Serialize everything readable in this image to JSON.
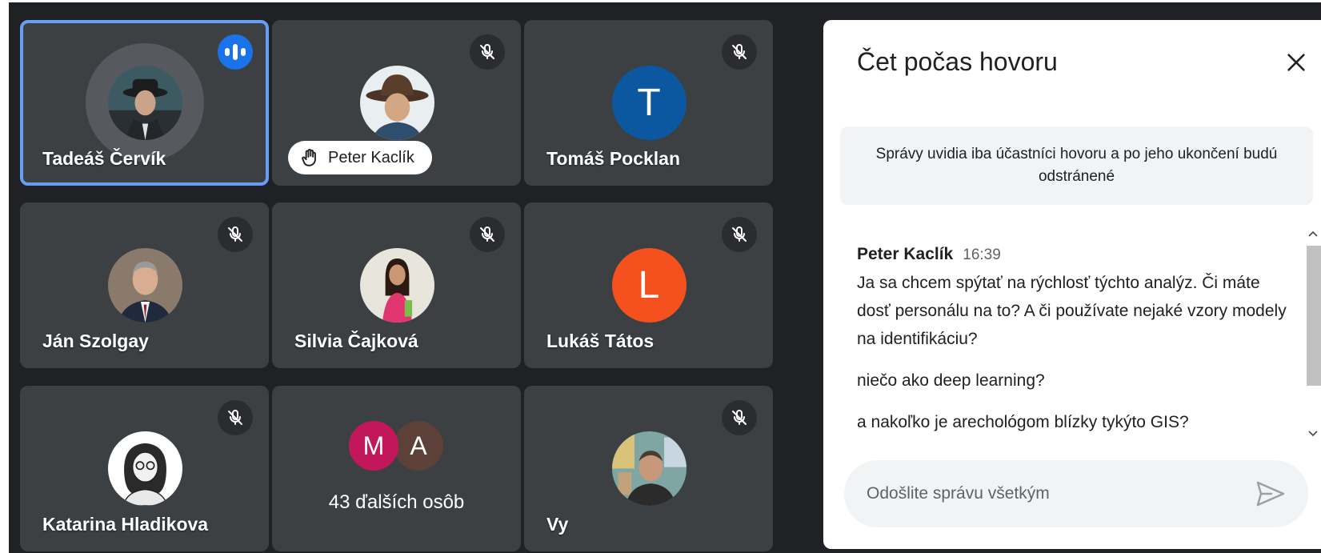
{
  "colors": {
    "background": "#202124",
    "tile": "#3c4043",
    "active_outline": "#669df6",
    "speaking_badge": "#1a73e8",
    "avatar_T": "#0b57a0",
    "avatar_L": "#f4511e",
    "avatar_M": "#c2185b",
    "avatar_A": "#5d4037"
  },
  "tiles": [
    {
      "name": "Tadeáš Červík",
      "icon": "speaking-indicator",
      "speaking": true
    },
    {
      "name": "Peter Kaclík",
      "icon": "raised-hand-icon",
      "muted": true
    },
    {
      "name": "Tomáš Pocklan",
      "avatar_letter": "T",
      "muted": true
    },
    {
      "name": "Ján Szolgay",
      "muted": true
    },
    {
      "name": "Silvia Čajková",
      "muted": true
    },
    {
      "name": "Lukáš Tátos",
      "avatar_letter": "L",
      "muted": true
    },
    {
      "name": "Katarina Hladikova",
      "muted": true
    },
    {
      "others_label": "43 ďalších osôb",
      "avatars": [
        "M",
        "A"
      ]
    },
    {
      "name": "Vy",
      "muted": true
    }
  ],
  "chat": {
    "title": "Čet počas hovoru",
    "notice": "Správy uvidia iba účastníci hovoru a po jeho ukončení budú odstránené",
    "messages": {
      "sender": "Peter Kaclík",
      "time": "16:39",
      "lines": [
        "Ja sa chcem spýtať na rýchlosť týchto analýz. Či máte dosť personálu na to? A či používate nejaké vzory modely na identifikáciu?",
        "niečo ako deep learning?",
        "a nakoľko je arechológom blízky tykýto GIS?"
      ]
    },
    "input_placeholder": "Odošlite správu všetkým"
  }
}
